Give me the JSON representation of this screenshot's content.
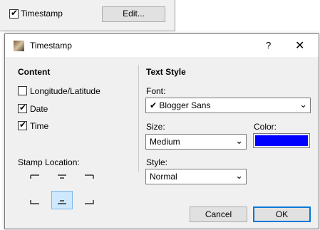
{
  "parent": {
    "timestamp_checkbox": {
      "label": "Timestamp",
      "checked": true
    },
    "edit_button": "Edit..."
  },
  "dialog": {
    "title": "Timestamp",
    "help": "?",
    "close": "✕",
    "content": {
      "heading": "Content",
      "checkboxes": [
        {
          "label": "Longitude/Latitude",
          "checked": false
        },
        {
          "label": "Date",
          "checked": true
        },
        {
          "label": "Time",
          "checked": true
        }
      ],
      "stamp_location_label": "Stamp Location:",
      "stamp_locations": [
        "top-left",
        "top-center",
        "top-right",
        "bottom-left",
        "bottom-center",
        "bottom-right"
      ],
      "selected_location": "bottom-center"
    },
    "text_style": {
      "heading": "Text Style",
      "font_label": "Font:",
      "font_value": "Blogger Sans",
      "font_check": "✔",
      "size_label": "Size:",
      "size_value": "Medium",
      "color_label": "Color:",
      "color_value": "#0000ff",
      "style_label": "Style:",
      "style_value": "Normal"
    },
    "buttons": {
      "cancel": "Cancel",
      "ok": "OK"
    }
  },
  "icons": {
    "checkmark": "check-icon",
    "dropdown": "chevron-down-icon",
    "close": "close-icon",
    "help": "help-icon",
    "app": "timestamp-app-icon"
  },
  "colors": {
    "accent": "#0078d7",
    "selection": "#cde8ff",
    "stamp_color": "#0000ff"
  }
}
